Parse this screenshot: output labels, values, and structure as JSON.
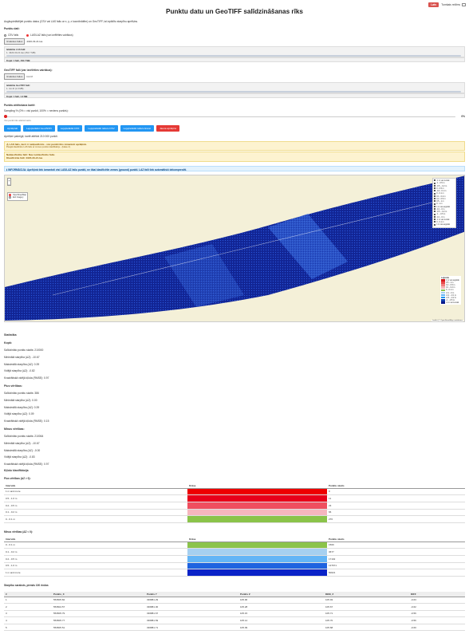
{
  "header": {
    "lang_label": "Latv",
    "theme_label": "Tumšais režīms"
  },
  "title": "Punktu datu un GeoTIFF salīdzināšanas rīks",
  "description": "Augšupielādējiet punktu datus (CSV vai LAS failu ar x, y, z koordinātēm) un GeoTIFF, lai izpildītu starpību aprēķinu.",
  "point_section": {
    "label": "Punktu dati:",
    "radio_csv": "CSV fails",
    "radio_las": "LAS/LAZ fails (var izvēlēties vairākus)",
    "choose_btn": "Izvēlēties failus",
    "chosen": "4320-33-21.las",
    "loaded_label": "Ielādētie LAS faili:",
    "loaded_file": "1. 4320-33-21.las (152.7 MB)",
    "total": "Kopā: 1 faili, 152.7 MB"
  },
  "geotiff_section": {
    "label": "GeoTIFF faili (var izvēlēties vairākus):",
    "choose_btn": "Izvēlēties failus",
    "chosen": "tmr.tif",
    "loaded_label": "Ielādētie GeoTIFF faili:",
    "loaded_file": "1. tmr.tif (1.0 MB)",
    "total": "Kopā: 1 faili, 1.0 MB"
  },
  "sampling": {
    "label": "Punktu attēlošana kartē:",
    "desc": "Sampling % (0% = visi punkti, 100% = neviens punkts):",
    "value": "0%",
    "hint": "Visi punkti tiks attēloti kartē."
  },
  "buttons": [
    "Aprēķināt",
    "Lejupielādēt GeoJSON",
    "Lejupielādēt DXF",
    "Lejupielādēt tabulu CSV",
    "Lejupielādēt tabulu Excel",
    "Jauna aprēķins"
  ],
  "status": "Aprēķini pabeigti, kartē attēloti 210 000 punkti.",
  "warning1": {
    "title": "⚠ LAS fails, kurš ir nekļasificēts - visi punkti tiks izmantoti aprēķinā.",
    "sub": "Pieejāt klasificētu LAS failu ar zemes punktu klasifikāciju - (klase 2)."
  },
  "warning2": {
    "title": "Nekļasificētie faili: Nav neklasificēto failu",
    "sub": "Klasificētie faili: 4320-33-21.las"
  },
  "info": "ℹ INFORMĀCIJA: Aprēķinā tiek izmantoti visi LAS/LAZ failu punkti, ne tikai klasificētie zemes (ground) punkti. LAZ faili tiek automātiski dekompresēti.",
  "map": {
    "basemap_opts": [
      "OpenStreetMap",
      "Esri Imagery"
    ],
    "layers": [
      "-1 m vai zemāk",
      "-1 - 0.5 m",
      "-0.5 - -0.2 m",
      "0 - 0.5 m",
      "-0.2 - 0.1 m",
      "0 - 0.1 m",
      "0.1 - 0.2 m",
      "0.2 - 0.5 m",
      "0.5 - 1 m",
      "0 - 1 m",
      "1 m vai augstāk",
      "-0.1 - 0 m",
      "-0.5 - -0.2 m",
      "-1 - -0.5 m",
      "-0.1 - 0 m",
      "-1 m vai zemāk",
      "0 - 0.1 m",
      "1 m vai augstāk"
    ],
    "legend_title": "Leģenda",
    "legend": [
      {
        "label": "1 m vai augstāk",
        "color": "#d7191c"
      },
      {
        "label": "0.5 - 1 m",
        "color": "#e8494a"
      },
      {
        "label": "0.2 - 0.5 m",
        "color": "#f08080"
      },
      {
        "label": "0.1 - 0.2 m",
        "color": "#f4b6b6"
      },
      {
        "label": "0 - 0.1 m",
        "color": "#8bc34a"
      },
      {
        "label": "-0.1 - 0 m",
        "color": "#a6d0f0"
      },
      {
        "label": "-0.2 - -0.1 m",
        "color": "#64b5f6"
      },
      {
        "label": "-0.5 - -0.2 m",
        "color": "#2196f3"
      },
      {
        "label": "-1 - -0.5 m",
        "color": "#1140b0"
      },
      {
        "label": "-1 m vai zemāk",
        "color": "#0a1a8a"
      }
    ],
    "attribution": "Leaflet | © OpenStreetMap contributors"
  },
  "stats": {
    "title": "Statistika",
    "total_h": "Kopā:",
    "total": [
      "Salīdzināto punktu skaits: 210000",
      "Minimālā starpība (ΔZ): -10.67",
      "Maksimālā starpība (ΔZ): 0.39",
      "Vidējā starpība (ΔZ): -0.82",
      "Kvadrātiskā vidējā kļūda (RMSE): 0.97"
    ],
    "plus_h": "Plus vērtības:",
    "plus": [
      "Salīdzināto punktu skaits: 386",
      "Minimālā starpība (ΔZ): 0.00",
      "Maksimālā starpība (ΔZ): 0.39",
      "Vidējā starpība (ΔZ): 0.09",
      "Kvadrātiskā vidējā kļūda (RMSE): 0.15"
    ],
    "minus_h": "Mīnus vērtības:",
    "minus": [
      "Salīdzināto punktu skaits: 210064",
      "Minimālā starpība (ΔZ): -10.67",
      "Maksimālā starpība (ΔZ): -0.00",
      "Vidējā starpība (ΔZ): -0.83",
      "Kvadrātiskā vidējā kļūda (RMSE): 0.97"
    ],
    "class_h": "Kļūdu klasifikācija"
  },
  "plus_table": {
    "title": "Plus vērtības (ΔZ > 0):",
    "headers": [
      "Intervāls",
      "Krāsa",
      "Punktu skaits"
    ],
    "rows": [
      {
        "r": "1 m and more",
        "c": "#ee0000",
        "n": "0"
      },
      {
        "r": "0.5 - 1.0 m",
        "c": "#e8001a",
        "n": "11"
      },
      {
        "r": "0.2 - 0.5 m",
        "c": "#ef4f5f",
        "n": "23"
      },
      {
        "r": "0.1 - 0.2 m",
        "c": "#f6b6be",
        "n": "66"
      },
      {
        "r": "0 - 0.1 m",
        "c": "#8bc34a",
        "n": "276"
      }
    ]
  },
  "minus_table": {
    "title": "Mīnus vērtības (ΔZ < 0):",
    "headers": [
      "Intervāls",
      "Krāsa",
      "Punktu skaits"
    ],
    "rows": [
      {
        "r": "0 - 0.1 m",
        "c": "#8bc34a",
        "n": "1560"
      },
      {
        "r": "0.1 - 0.2 m",
        "c": "#a6d0f0",
        "n": "3677"
      },
      {
        "r": "0.2 - 0.5 m",
        "c": "#64b5f6",
        "n": "17102"
      },
      {
        "r": "0.5 - 1.0 m",
        "c": "#1e63e0",
        "n": "137671"
      },
      {
        "r": "1 m and more",
        "c": "#0a23c8",
        "n": "50021"
      }
    ]
  },
  "diff_table": {
    "title": "Starpību saraksts, pirmās 100 rindas",
    "headers": [
      "#",
      "Punkts_X",
      "Punkts Y",
      "Punkts Z",
      "DEM_Z",
      "DIFF"
    ],
    "rows": [
      [
        "1",
        "553505.84",
        "336881.29",
        "105.96",
        "105.93",
        "-0.63"
      ],
      [
        "2",
        "553504.57",
        "336881.30",
        "105.28",
        "105.67",
        "-0.62"
      ],
      [
        "3",
        "553505.79",
        "336881.67",
        "105.15",
        "105.71",
        "-0.56"
      ],
      [
        "4",
        "553505.77",
        "336881.69",
        "105.14",
        "105.70",
        "-0.56"
      ],
      [
        "5",
        "553505.51",
        "336881.71",
        "105.09",
        "105.68",
        "-0.60"
      ]
    ]
  }
}
